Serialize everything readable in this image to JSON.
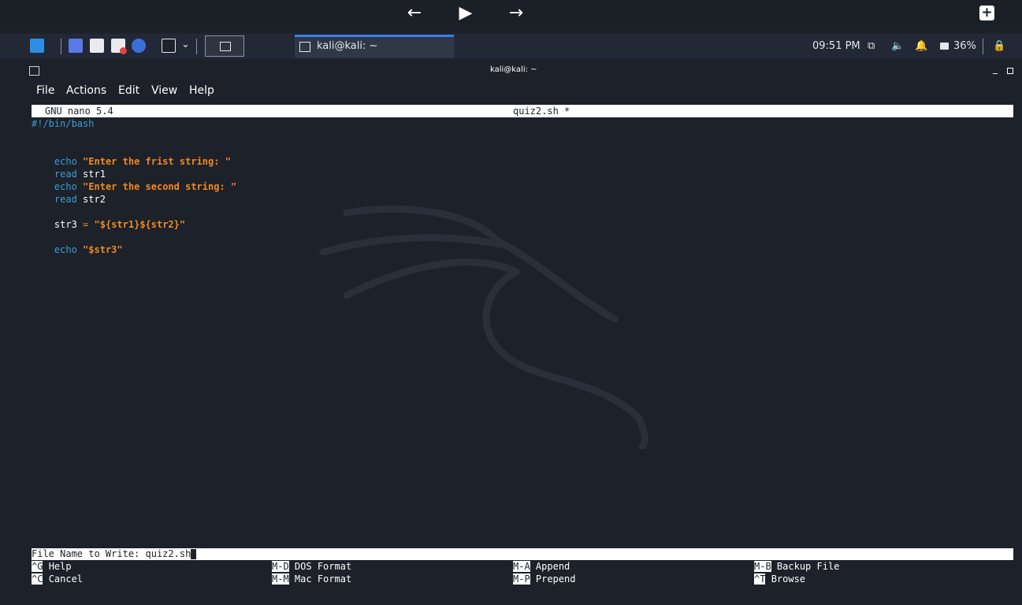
{
  "topnav": {
    "back": "←",
    "play": "▶",
    "forward": "→",
    "plus": "+"
  },
  "taskbar": {
    "task_title": "kali@kali: ~",
    "clock": "09:51 PM",
    "battery": "36%"
  },
  "window": {
    "title": "kali@kali: ~"
  },
  "menu": {
    "items": [
      "File",
      "Actions",
      "Edit",
      "View",
      "Help"
    ]
  },
  "nano": {
    "version": "GNU nano 5.4",
    "filename": "quiz2.sh *",
    "lines": {
      "l1": "#!/bin/bash",
      "l3_kw": "echo",
      "l3_str": "\"Enter the frist string: \"",
      "l4_kw": "read",
      "l4_var": "str1",
      "l5_kw": "echo",
      "l5_str": "\"Enter the second string: \"",
      "l6_kw": "read",
      "l6_var": "str2",
      "l8_var": "str3",
      "l8_eq": "=",
      "l8_str": "\"${str1}${str2}\"",
      "l10_kw": "echo",
      "l10_str": "\"$str3\""
    },
    "prompt": "File Name to Write: quiz2.sh",
    "shortcuts": [
      {
        "key": "^G",
        "label": "Help"
      },
      {
        "key": "^C",
        "label": "Cancel"
      },
      {
        "key": "M-D",
        "label": "DOS Format"
      },
      {
        "key": "M-M",
        "label": "Mac Format"
      },
      {
        "key": "M-A",
        "label": "Append"
      },
      {
        "key": "M-P",
        "label": "Prepend"
      },
      {
        "key": "M-B",
        "label": "Backup File"
      },
      {
        "key": "^T",
        "label": "Browse"
      }
    ]
  }
}
